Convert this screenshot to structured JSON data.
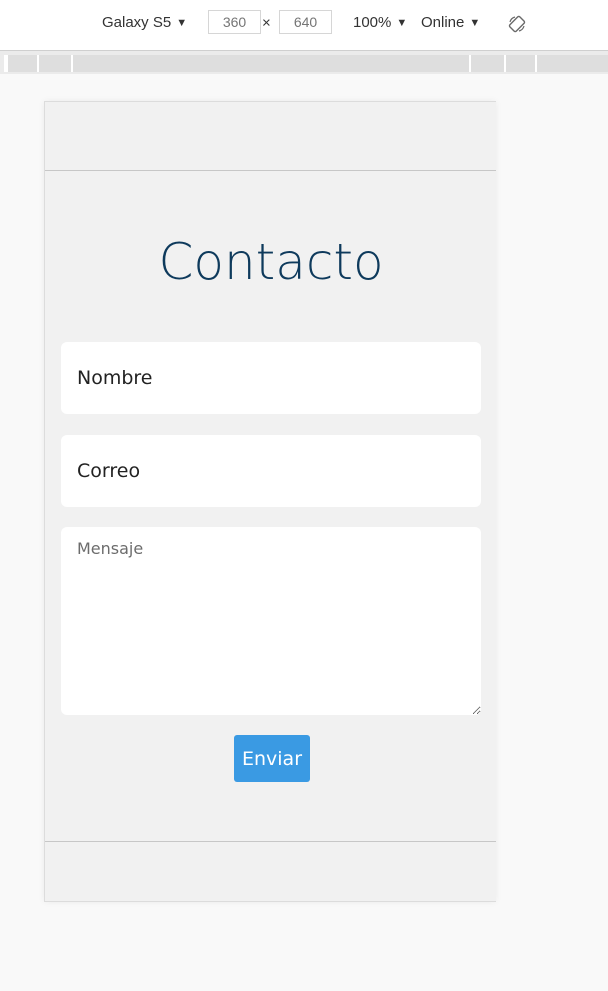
{
  "toolbar": {
    "device": "Galaxy S5",
    "width": "360",
    "height": "640",
    "times": "×",
    "zoom": "100%",
    "network": "Online",
    "caret": "▼"
  },
  "page": {
    "title": "Contacto",
    "name_placeholder": "Nombre",
    "email_placeholder": "Correo",
    "message_placeholder": "Mensaje",
    "send_label": "Enviar"
  },
  "colors": {
    "title": "#0e3a5c",
    "button": "#3a9ae3",
    "page_background": "#f1f1f1"
  },
  "icons": {
    "rotate": "rotate-icon"
  }
}
